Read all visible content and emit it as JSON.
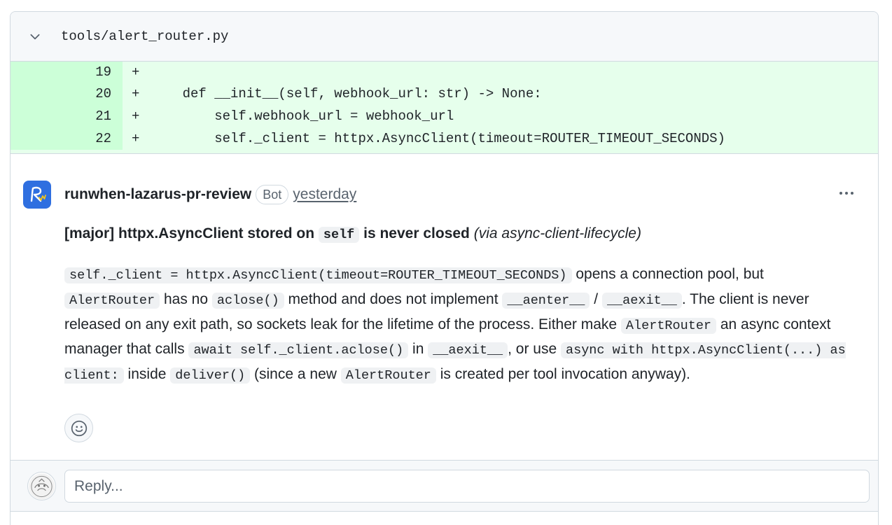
{
  "file": {
    "path": "tools/alert_router.py"
  },
  "diff": {
    "lines": [
      {
        "num": "19",
        "marker": "+",
        "code": ""
      },
      {
        "num": "20",
        "marker": "+",
        "code": "    def __init__(self, webhook_url: str) -> None:"
      },
      {
        "num": "21",
        "marker": "+",
        "code": "        self.webhook_url = webhook_url"
      },
      {
        "num": "22",
        "marker": "+",
        "code": "        self._client = httpx.AsyncClient(timeout=ROUTER_TIMEOUT_SECONDS)"
      }
    ]
  },
  "comment": {
    "author": "runwhen-lazarus-pr-review",
    "badge": "Bot",
    "timestamp": "yesterday",
    "title": {
      "prefix": "[major] httpx.AsyncClient stored on ",
      "code": "self",
      "suffix": " is never closed ",
      "via": "(via async-client-lifecycle)"
    },
    "body": {
      "c1": "self._client = httpx.AsyncClient(timeout=ROUTER_TIMEOUT_SECONDS)",
      "t1": " opens a connection pool, but ",
      "c2": "AlertRouter",
      "t2": " has no ",
      "c3": "aclose()",
      "t3": " method and does not implement ",
      "c4": "__aenter__",
      "t4": " / ",
      "c5": "__aexit__",
      "t5": ". The client is never released on any exit path, so sockets leak for the lifetime of the process. Either make ",
      "c6": "AlertRouter",
      "t6": " an async context manager that calls ",
      "c7": "await self._client.aclose()",
      "t7": " in ",
      "c8": "__aexit__",
      "t8": ", or use ",
      "c9": "async with httpx.AsyncClient(...) as client:",
      "t9": " inside ",
      "c10": "deliver()",
      "t10": " (since a new ",
      "c11": "AlertRouter",
      "t11": " is created per tool invocation anyway)."
    }
  },
  "reply": {
    "placeholder": "Reply..."
  },
  "colors": {
    "diff_added_bg": "#e6ffec",
    "diff_added_num_bg": "#ccffd8",
    "border": "#d1d9e0",
    "muted_text": "#59636e",
    "bot_avatar": "#2f6fe0"
  }
}
